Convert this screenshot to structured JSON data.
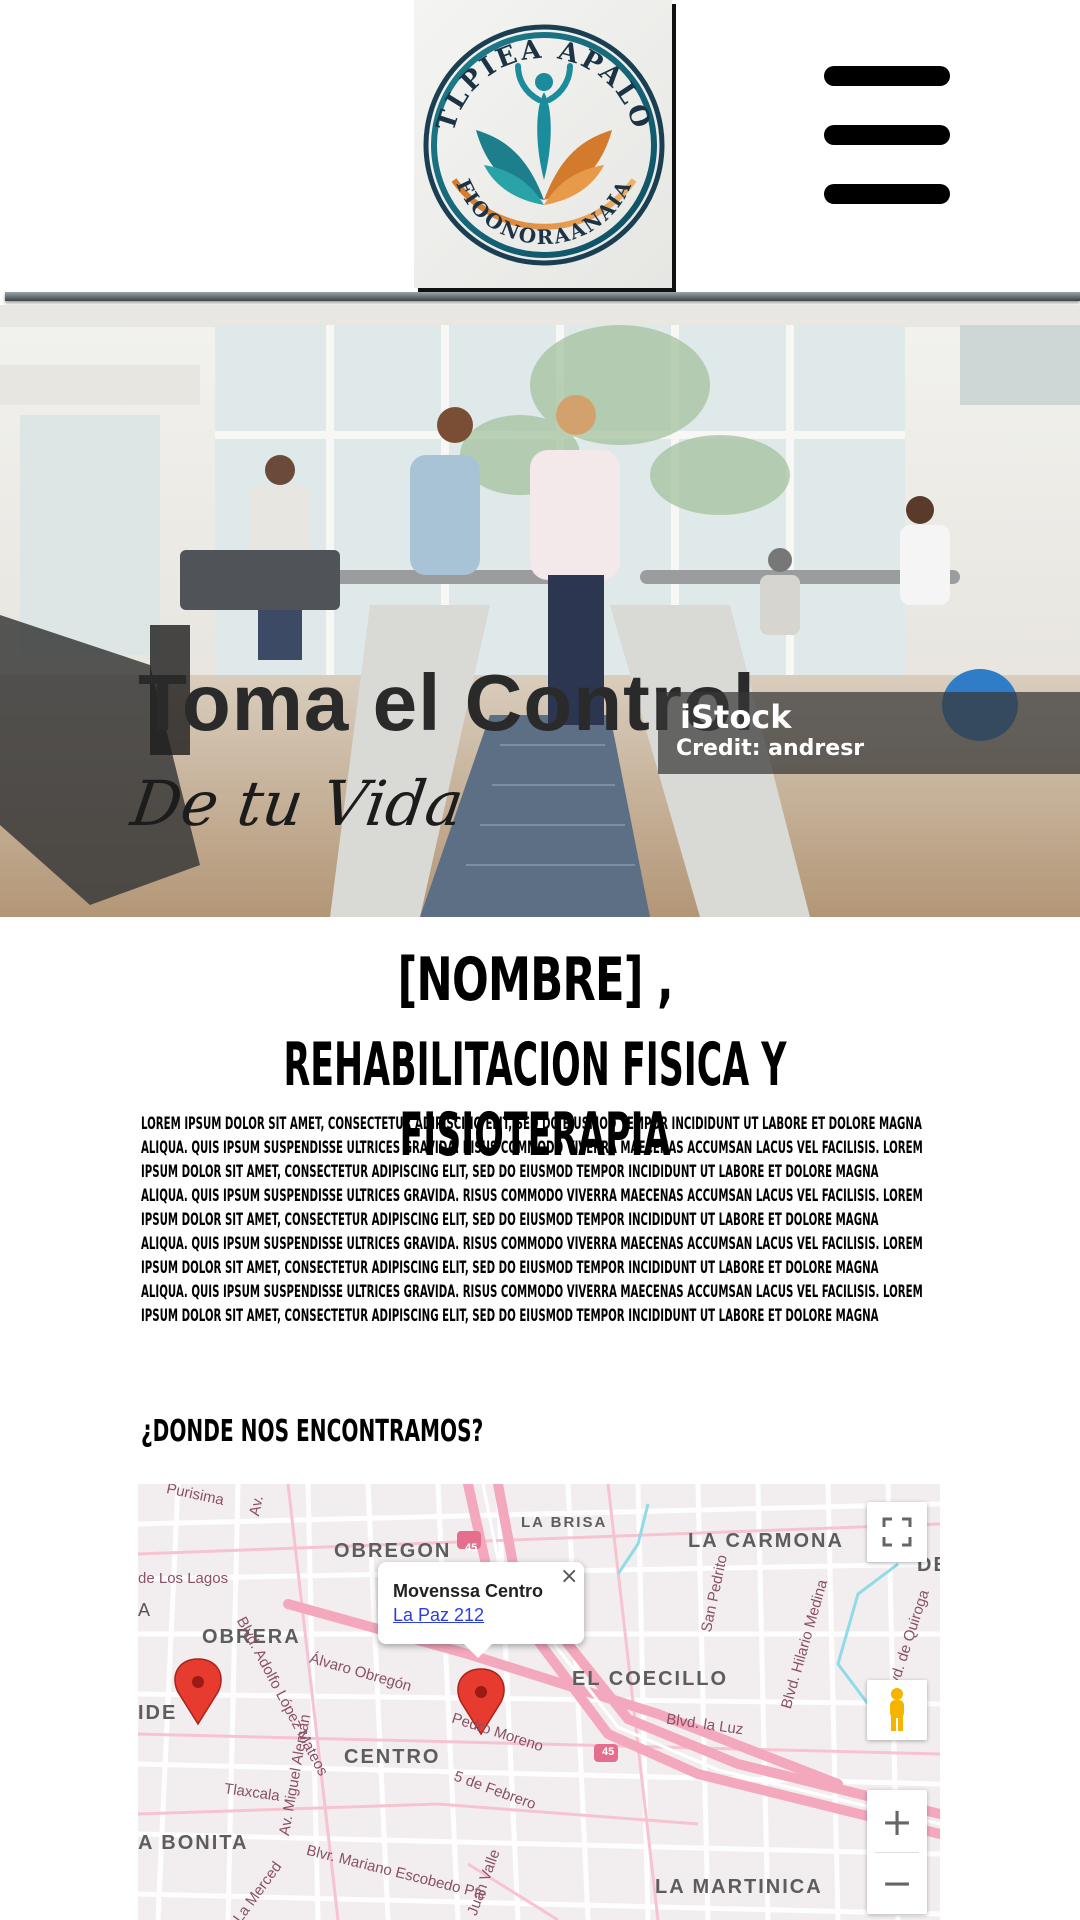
{
  "header": {
    "logo_top_text": "TLPIEA APALO",
    "logo_bottom_text": "FIOONORAANAIA",
    "menu_icon": "hamburger-menu-icon"
  },
  "hero": {
    "title": "Toma el Control",
    "subtitle": "De tu Vida",
    "stock_brand": "iStock",
    "credit": "Credit: andresr"
  },
  "content": {
    "name_line": "[NOMBRE] ,",
    "subtitle_line": "REHABILITACION FISICA Y FISIOTERAPIA",
    "lorem_paragraph": "Lorem ipsum dolor sit amet, consectetur adipiscing elit, sed do eiusmod tempor incididunt ut labore et dolore magna aliqua. Quis ipsum suspendisse ultrices gravida. Risus commodo viverra maecenas accumsan lacus vel facilisis. Lorem ipsum dolor sit amet, consectetur adipiscing elit, sed do eiusmod tempor incididunt ut labore et dolore magna aliqua. Quis ipsum suspendisse ultrices gravida. Risus commodo viverra maecenas accumsan lacus vel facilisis. Lorem ipsum dolor sit amet, consectetur adipiscing elit, sed do eiusmod tempor incididunt ut labore et dolore magna aliqua. Quis ipsum suspendisse ultrices gravida. Risus commodo viverra maecenas accumsan lacus vel facilisis. Lorem ipsum dolor sit amet, consectetur adipiscing elit, sed do eiusmod tempor incididunt ut labore et dolore magna aliqua. Quis ipsum suspendisse ultrices gravida. Risus commodo viverra maecenas accumsan lacus vel facilisis. Lorem ipsum dolor sit amet, consectetur adipiscing elit, sed do eiusmod tempor incididunt ut labore et dolore magna",
    "where_heading": "¿DONDE NOS ENCONTRAMOS?"
  },
  "map": {
    "info_title": "Movenssa Centro",
    "info_link": "La Paz 212",
    "close_symbol": "×",
    "zoom_in": "+",
    "zoom_out": "−",
    "highway_number": "45",
    "neighborhoods": {
      "obregon": "OBREGON",
      "la_brisa": "LA BRISA",
      "la_carmona": "LA CARMONA",
      "de": "DE",
      "obrera": "OBRERA",
      "el_coecillo": "EL COECILLO",
      "ide": "IDE",
      "centro": "CENTRO",
      "a_bonita": "A BONITA",
      "la_martinica": "LA MARTINICA"
    },
    "streets": {
      "purisima": "Purisima",
      "de_los_lagos": "de Los Lagos",
      "a": "A",
      "adolfo": "Blvd. Adolfo López Mateos",
      "alvaro": "Álvaro Obregón",
      "pedro_moreno": "Pedro Moreno",
      "miguel_aleman": "Av. Miguel Alemán",
      "cinco_febrero": "5 de Febrero",
      "tlaxcala": "Tlaxcala",
      "blvd_la_luz": "Blvd. la Luz",
      "san_pedrito": "San Pedrito",
      "hilario": "Blvd. Hilario Medina",
      "quiroga": "Blvd. de Quiroga",
      "mariano": "Blvr. Mariano Escobedo Pte",
      "juan_valle": "Juan Valle",
      "la_merced": "La Merced",
      "av": "Av."
    },
    "controls": [
      "fullscreen-icon",
      "pegman-icon",
      "zoom-in-icon",
      "zoom-out-icon"
    ]
  },
  "colors": {
    "text": "#000000",
    "hero_title": "#2a2a2a",
    "map_link": "#2b3ee0",
    "map_road": "#f4a8bd",
    "map_pin": "#e63b2e"
  }
}
